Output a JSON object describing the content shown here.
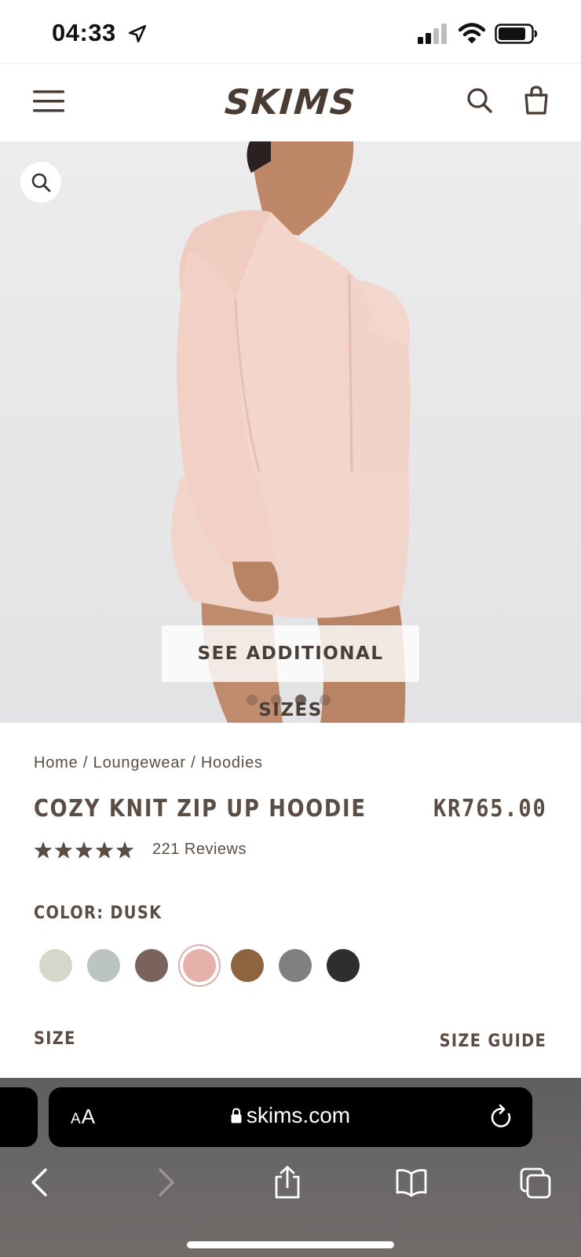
{
  "status_bar": {
    "time": "04:33",
    "icons": [
      "location-arrow-icon",
      "cellular-signal-icon",
      "wifi-icon",
      "battery-icon"
    ]
  },
  "header": {
    "logo": "SKIMS",
    "icons": [
      "menu-icon",
      "search-icon",
      "shopping-bag-icon"
    ]
  },
  "hero": {
    "zoom_icon": "magnifier-icon",
    "see_sizes_label": "SEE ADDITIONAL SIZES",
    "carousel": {
      "count": 4,
      "active_index": 2
    }
  },
  "breadcrumb": {
    "items": [
      "Home",
      "Loungewear",
      "Hoodies"
    ],
    "separator": " / "
  },
  "product": {
    "title": "COZY KNIT ZIP UP HOODIE",
    "price": "KR765.00",
    "rating_stars": 5,
    "reviews_label": "221 Reviews"
  },
  "color": {
    "label": "COLOR: DUSK",
    "selected_index": 3,
    "swatches": [
      "#d7d6cb",
      "#bcc4c3",
      "#7b625c",
      "#e6b1ab",
      "#8d6440",
      "#808080",
      "#2e2e30"
    ]
  },
  "size": {
    "label": "SIZE",
    "guide_label": "SIZE GUIDE"
  },
  "browser": {
    "aa_small": "A",
    "aa_large": "A",
    "url": "skims.com",
    "toolbar_icons": [
      "back-icon",
      "forward-icon",
      "share-icon",
      "bookmarks-icon",
      "tabs-icon"
    ]
  },
  "colors": {
    "text": "#5b4d43",
    "hoodie": "#f3d4cc"
  }
}
